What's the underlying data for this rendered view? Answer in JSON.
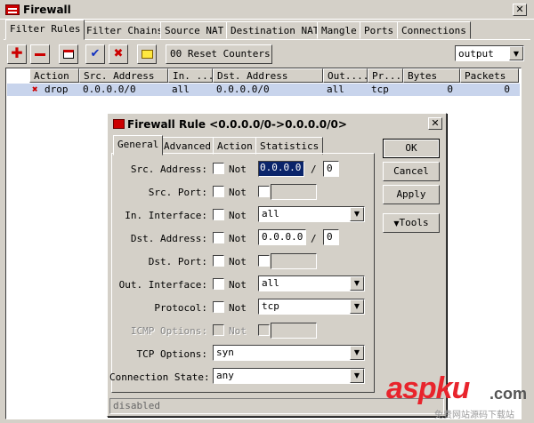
{
  "window": {
    "title": "Firewall"
  },
  "tabs": [
    {
      "label": "Filter Rules",
      "active": true
    },
    {
      "label": "Filter Chains"
    },
    {
      "label": "Source NAT"
    },
    {
      "label": "Destination NAT"
    },
    {
      "label": "Mangle"
    },
    {
      "label": "Ports"
    },
    {
      "label": "Connections"
    }
  ],
  "toolbar": {
    "add_icon": "plus-icon",
    "remove_icon": "minus-icon",
    "reset_counters_label": "00 Reset Counters",
    "chain_select": "output"
  },
  "table": {
    "headers": [
      "Action",
      "Src. Address",
      "In. ...",
      "Dst. Address",
      "Out....",
      "Pr...",
      "Bytes",
      "Packets"
    ],
    "rows": [
      {
        "action": "drop",
        "src": "0.0.0.0/0",
        "in": "all",
        "dst": "0.0.0.0/0",
        "out": "all",
        "proto": "tcp",
        "bytes": "0",
        "packets": "0"
      }
    ]
  },
  "dialog": {
    "title": "Firewall Rule <0.0.0.0/0->0.0.0.0/0>",
    "tabs": [
      "General",
      "Advanced",
      "Action",
      "Statistics"
    ],
    "not_label": "Not",
    "fields": {
      "src_address": {
        "label": "Src. Address:",
        "value": "0.0.0.0",
        "mask": "0"
      },
      "src_port": {
        "label": "Src. Port:"
      },
      "in_interface": {
        "label": "In. Interface:",
        "value": "all"
      },
      "dst_address": {
        "label": "Dst. Address:",
        "value": "0.0.0.0",
        "mask": "0"
      },
      "dst_port": {
        "label": "Dst. Port:"
      },
      "out_interface": {
        "label": "Out. Interface:",
        "value": "all"
      },
      "protocol": {
        "label": "Protocol:",
        "value": "tcp"
      },
      "icmp_options": {
        "label": "ICMP Options:"
      },
      "tcp_options": {
        "label": "TCP Options:",
        "value": "syn"
      },
      "connection_state": {
        "label": "Connection State:",
        "value": "any"
      }
    },
    "buttons": {
      "ok": "OK",
      "cancel": "Cancel",
      "apply": "Apply",
      "tools": "Tools"
    },
    "status": "disabled"
  },
  "watermark": {
    "brand": "aspku",
    "suffix": ".com",
    "tagline": "免费网站源码下载站"
  }
}
